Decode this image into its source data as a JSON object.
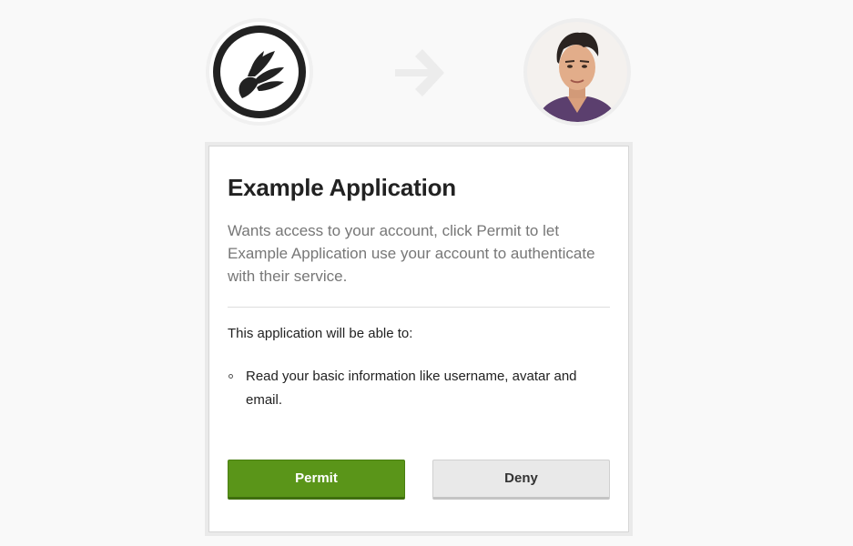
{
  "header": {
    "app_logo_icon": "winged-logo-icon",
    "arrow_icon": "arrow-right-icon",
    "user_avatar": "user-avatar-photo"
  },
  "card": {
    "title": "Example Application",
    "description": "Wants access to your account, click Permit to let Example Application use your account to authenticate with their service.",
    "scope_heading": "This application will be able to:",
    "scopes": [
      "Read your basic information like username, avatar and email."
    ],
    "permit_label": "Permit",
    "deny_label": "Deny"
  },
  "colors": {
    "permit_button": "#5a9519",
    "deny_button": "#e9e9e9",
    "background": "#f9f9f9"
  }
}
